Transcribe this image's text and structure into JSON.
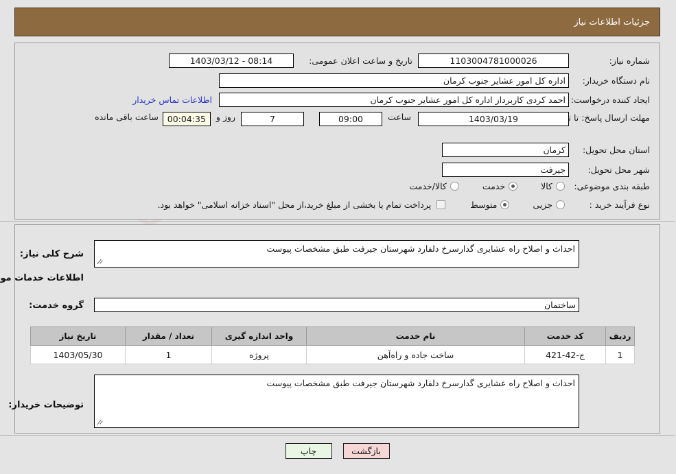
{
  "header": {
    "title": "جزئیات اطلاعات نیاز",
    "bg_color": "#8d6a3f"
  },
  "watermark": {
    "text": "AriaTender",
    "suffix": ".net",
    "shield_color": "#d9b8b8"
  },
  "top_form": {
    "need_number_label": "شماره نیاز:",
    "need_number_value": "1103004781000026",
    "public_announce_label": "تاریخ و ساعت اعلان عمومی:",
    "public_announce_value": "08:14 - 1403/03/12",
    "buyer_org_label": "نام دستگاه خریدار:",
    "buyer_org_value": "اداره کل امور عشایر جنوب کرمان",
    "creator_label": "ایجاد کننده درخواست:",
    "creator_value": "احمد کردی   کاربرداز اداره کل امور عشایر جنوب کرمان",
    "contact_link": "اطلاعات تماس خریدار",
    "deadline_label": "مهلت ارسال پاسخ: تا تاریخ:",
    "deadline_date": "1403/03/19",
    "hour_label": "ساعت",
    "hour_value": "09:00",
    "days_value": "7",
    "days_label": "روز و",
    "countdown_value": "00:04:35",
    "countdown_label": "ساعت باقی مانده",
    "province_label": "استان محل تحویل:",
    "province_value": "کرمان",
    "city_label": "شهر محل تحویل:",
    "city_value": "جیرفت",
    "category_label": "طبقه بندی موضوعی:",
    "category_options": [
      {
        "label": "کالا",
        "selected": false
      },
      {
        "label": "خدمت",
        "selected": true
      },
      {
        "label": "کالا/خدمت",
        "selected": false
      }
    ],
    "process_label": "نوع فرآیند خرید :",
    "process_options": [
      {
        "label": "جزیی",
        "selected": false
      },
      {
        "label": "متوسط",
        "selected": true
      }
    ],
    "treasury_checkbox_checked": false,
    "treasury_note": "پرداخت تمام یا بخشی از مبلغ خرید،از محل \"اسناد خزانه اسلامی\" خواهد بود."
  },
  "mid_section": {
    "general_desc_label": "شرح کلی نیاز:",
    "general_desc_value": "احداث و اصلاح راه عشایری گدارسرخ دلفارد شهرستان جیرفت طبق مشخصات پیوست",
    "services_info_heading": "اطلاعات خدمات مورد نیاز",
    "service_group_label": "گروه خدمت:",
    "service_group_value": "ساختمان"
  },
  "service_table": {
    "columns": [
      "ردیف",
      "کد خدمت",
      "نام خدمت",
      "واحد اندازه گیری",
      "تعداد / مقدار",
      "تاریخ نیاز"
    ],
    "rows": [
      {
        "row_no": "1",
        "service_code": "ج-42-421",
        "service_name": "ساخت جاده و راه‌آهن",
        "unit": "پروژه",
        "quantity": "1",
        "need_date": "1403/05/30"
      }
    ]
  },
  "buyer_notes": {
    "label": "توضیحات خریدار:",
    "value": "احداث و اصلاح راه عشایری گدارسرخ دلفارد شهرستان جیرفت طبق مشخصات پیوست"
  },
  "buttons": {
    "print": "چاپ",
    "back": "بازگشت"
  }
}
